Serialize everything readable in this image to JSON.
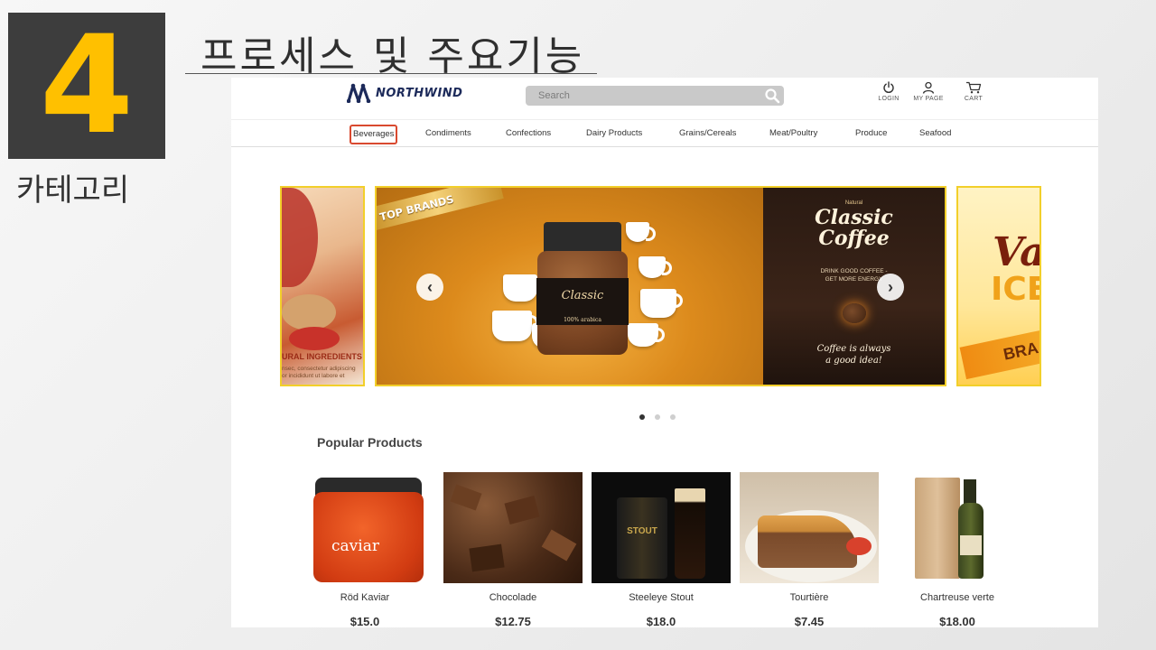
{
  "slide": {
    "number": "4",
    "title": "프로세스 및 주요기능",
    "side_label": "카테고리"
  },
  "site": {
    "logo_text": "NORTHWIND",
    "search_placeholder": "Search",
    "utility": [
      {
        "icon": "power-icon",
        "label": "LOGIN"
      },
      {
        "icon": "user-icon",
        "label": "MY PAGE"
      },
      {
        "icon": "cart-icon",
        "label": "CART"
      }
    ],
    "categories": [
      {
        "label": "Beverages",
        "active": true
      },
      {
        "label": "Condiments",
        "active": false
      },
      {
        "label": "Confections",
        "active": false
      },
      {
        "label": "Dairy Products",
        "active": false
      },
      {
        "label": "Grains/Cereals",
        "active": false
      },
      {
        "label": "Meat/Poultry",
        "active": false
      },
      {
        "label": "Produce",
        "active": false
      },
      {
        "label": "Seafood",
        "active": false
      }
    ],
    "carousel": {
      "left_slide": {
        "caption": "URAL INGREDIENTS",
        "small_text_1": "nsec, consectetur adipiscing",
        "small_text_2": "or incididunt ut labore et"
      },
      "main_slide": {
        "ribbon": "TOP BRANDS",
        "jar_label": "Classic",
        "jar_small": "100% arabica",
        "right_natural": "Natural",
        "right_title_1": "Classic",
        "right_title_2": "Coffee",
        "right_sub_1": "DRINK GOOD COFFEE -",
        "right_sub_2": "GET MORE ENERGY",
        "right_tag_1": "Coffee is always",
        "right_tag_2": "a good idea!"
      },
      "right_slide": {
        "text_1": "Va",
        "text_2": "ICE",
        "text_3": "BRA"
      },
      "dots_total": 3,
      "active_dot": 1
    },
    "popular": {
      "title": "Popular Products",
      "products": [
        {
          "name": "Röd Kaviar",
          "price": "$15.0"
        },
        {
          "name": "Chocolade",
          "price": "$12.75"
        },
        {
          "name": "Steeleye Stout",
          "price": "$18.0"
        },
        {
          "name": "Tourtière",
          "price": "$7.45"
        },
        {
          "name": "Chartreuse verte",
          "price": "$18.00"
        }
      ]
    },
    "colors": {
      "accent_slide_number": "#ffc000",
      "active_category_border": "#d9492f",
      "carousel_border": "#f2cf2a"
    }
  }
}
